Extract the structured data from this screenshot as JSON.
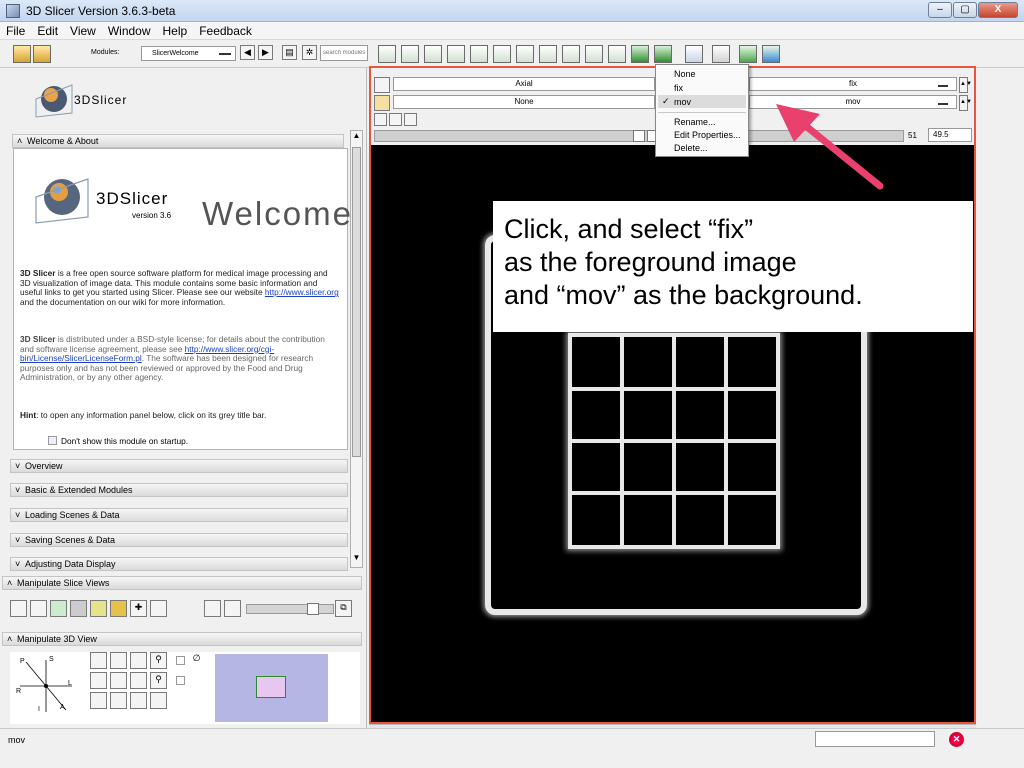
{
  "window": {
    "title": "3D Slicer Version 3.6.3-beta",
    "min_label": "–",
    "max_label": "▢",
    "close_label": "X"
  },
  "menu": [
    "File",
    "Edit",
    "View",
    "Window",
    "Help",
    "Feedback"
  ],
  "toolbar": {
    "modules_label": "Modules:",
    "module_value": "SlicerWelcome",
    "search_placeholder": "search modules"
  },
  "logo": {
    "text": "3DSlicer"
  },
  "welcome": {
    "section_title": "Welcome & About",
    "logo_text": "3DSlicer",
    "logo_version": "version 3.6",
    "heading": "Welcome",
    "p1_bold": "3D Slicer",
    "p1_a": " is a free open source software platform for medical image processing and 3D visualization of image data. This module contains some basic information and useful links to get you started using Slicer. Please see our website ",
    "p1_link": "http://www.slicer.org",
    "p1_b": " and the documentation on our wiki for more information.",
    "p2_bold": "3D Slicer",
    "p2_a": " is distributed under a BSD-style license; for details about the contribution and software license agreement, please see ",
    "p2_link": "http://www.slicer.org/cgi-bin/License/SlicerLicenseForm.pl",
    "p2_b": ". The software has been designed for research purposes only and has not been reviewed or approved by the Food and Drug Administration, or by any other agency.",
    "hint_bold": "Hint",
    "hint_text": ": to open any information panel below, click on its grey title bar.",
    "checkbox_label": "Don't show this module on startup."
  },
  "sections": [
    "Overview",
    "Basic & Extended Modules",
    "Loading Scenes & Data",
    "Saving Scenes & Data",
    "Adjusting Data Display"
  ],
  "manipulate_slice": {
    "title": "Manipulate Slice Views"
  },
  "manipulate_3d": {
    "title": "Manipulate 3D View",
    "compass": [
      "P",
      "S",
      "L",
      "R",
      "I",
      "A"
    ]
  },
  "slice_controls": {
    "orientation": "Axial",
    "foreground": "fix",
    "background_left": "None",
    "background": "mov",
    "slice_value": "51",
    "offset_value": "49.5"
  },
  "popup": {
    "items": [
      "None",
      "fix",
      "mov"
    ],
    "checked": "mov",
    "actions": [
      "Rename...",
      "Edit Properties...",
      "Delete..."
    ]
  },
  "annotation": {
    "lines": [
      "Click, and select “fix”",
      "as the foreground image",
      "and “mov” as the background."
    ],
    "arrow_color": "#e9406e"
  },
  "statusbar": {
    "text": "mov"
  },
  "colors": {
    "accent_red": "#e5553f",
    "arrow": "#e9406e",
    "link": "#1b3fc2"
  }
}
